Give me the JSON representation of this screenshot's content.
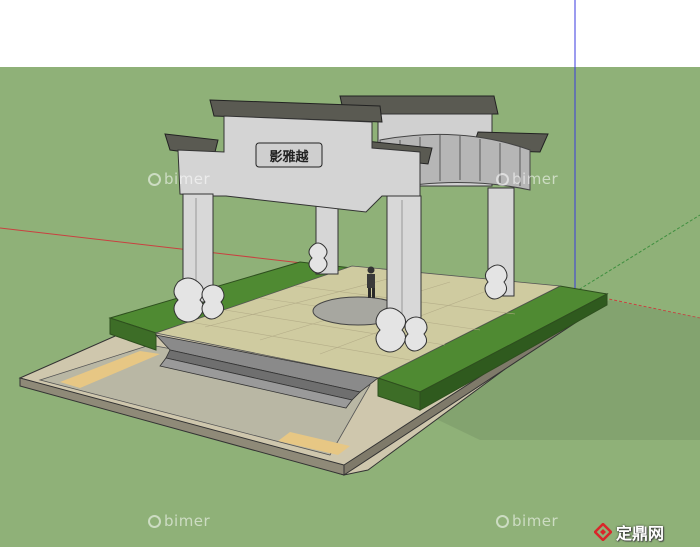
{
  "scene": {
    "sky_color": "#ffffff",
    "ground_color": "#8fb178",
    "pavilion_plaque_text": "影雅越"
  },
  "watermarks": [
    "bimer",
    "bimer",
    "bimer",
    "bimer"
  ],
  "brand": {
    "text": "定鼎网",
    "logo_color": "#d9262a"
  }
}
